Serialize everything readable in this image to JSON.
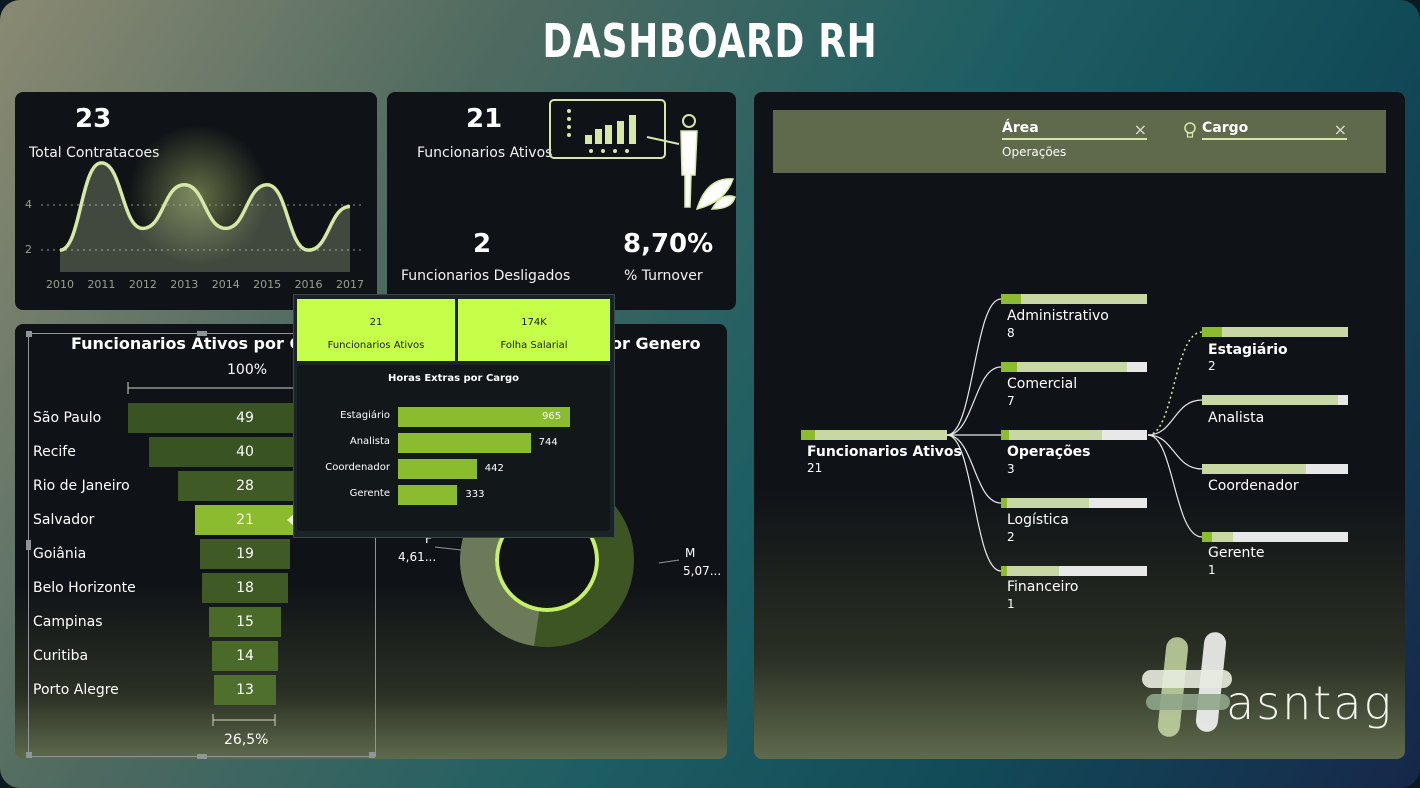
{
  "header": {
    "title": "DASHBOARD RH"
  },
  "contratacoes": {
    "value": "23",
    "label": "Total Contratacoes",
    "y_ticks": [
      "4",
      "2"
    ],
    "years": [
      "2010",
      "2011",
      "2012",
      "2013",
      "2014",
      "2015",
      "2016",
      "2017"
    ],
    "chart_data": {
      "type": "area",
      "x": [
        "2010",
        "2011",
        "2012",
        "2013",
        "2014",
        "2015",
        "2016",
        "2017"
      ],
      "values": [
        1,
        5,
        2,
        4,
        2,
        4,
        1,
        3
      ]
    }
  },
  "ativos": {
    "value": "21",
    "label": "Funcionarios Ativos"
  },
  "desligados": {
    "value": "2",
    "label": "Funcionarios Desligados"
  },
  "turnover": {
    "value": "8,70%",
    "label": "% Turnover"
  },
  "funnel": {
    "title": "Funcionarios Ativos por Cidade",
    "title_visible": "Funcionarios Ativos por Ci",
    "top_pct": "100%",
    "bottom_pct": "26,5%",
    "chart_data": {
      "type": "bar",
      "categories": [
        "São Paulo",
        "Recife",
        "Rio de Janeiro",
        "Salvador",
        "Goiânia",
        "Belo Horizonte",
        "Campinas",
        "Curitiba",
        "Porto Alegre"
      ],
      "values": [
        49,
        40,
        28,
        21,
        19,
        18,
        15,
        14,
        13
      ]
    }
  },
  "genero": {
    "title_visible": "or Genero",
    "f_label": "F",
    "f_value": "4,61...",
    "m_label": "M",
    "m_value": "5,07...",
    "chart_data": {
      "type": "pie",
      "categories": [
        "F",
        "M"
      ],
      "values": [
        4.61,
        5.07
      ]
    }
  },
  "tooltip": {
    "box1_value": "21",
    "box1_label": "Funcionarios Ativos",
    "box2_value": "174K",
    "box2_label": "Folha Salarial",
    "chart_title": "Horas Extras por Cargo",
    "chart_data": {
      "type": "bar",
      "categories": [
        "Estagiário",
        "Analista",
        "Coordenador",
        "Gerente"
      ],
      "values": [
        965,
        744,
        442,
        333
      ]
    }
  },
  "filters": {
    "area_label": "Área",
    "area_value": "Operações",
    "cargo_label": "Cargo",
    "clear_icon": "close-icon",
    "bulb_icon": "lightbulb-icon"
  },
  "tree": {
    "root": {
      "label": "Funcionarios Ativos",
      "value": "21"
    },
    "areas": [
      {
        "label": "Administrativo",
        "value": "8"
      },
      {
        "label": "Comercial",
        "value": "7"
      },
      {
        "label": "Operações",
        "value": "3"
      },
      {
        "label": "Logística",
        "value": "2"
      },
      {
        "label": "Financeiro",
        "value": "1"
      }
    ],
    "cargos": [
      {
        "label": "Estagiário",
        "value": "2"
      },
      {
        "label": "Analista",
        "value": ""
      },
      {
        "label": "Coordenador",
        "value": ""
      },
      {
        "label": "Gerente",
        "value": "1"
      }
    ]
  },
  "brand": {
    "logo_text": "asntag",
    "logo_full": "Hashtag"
  }
}
